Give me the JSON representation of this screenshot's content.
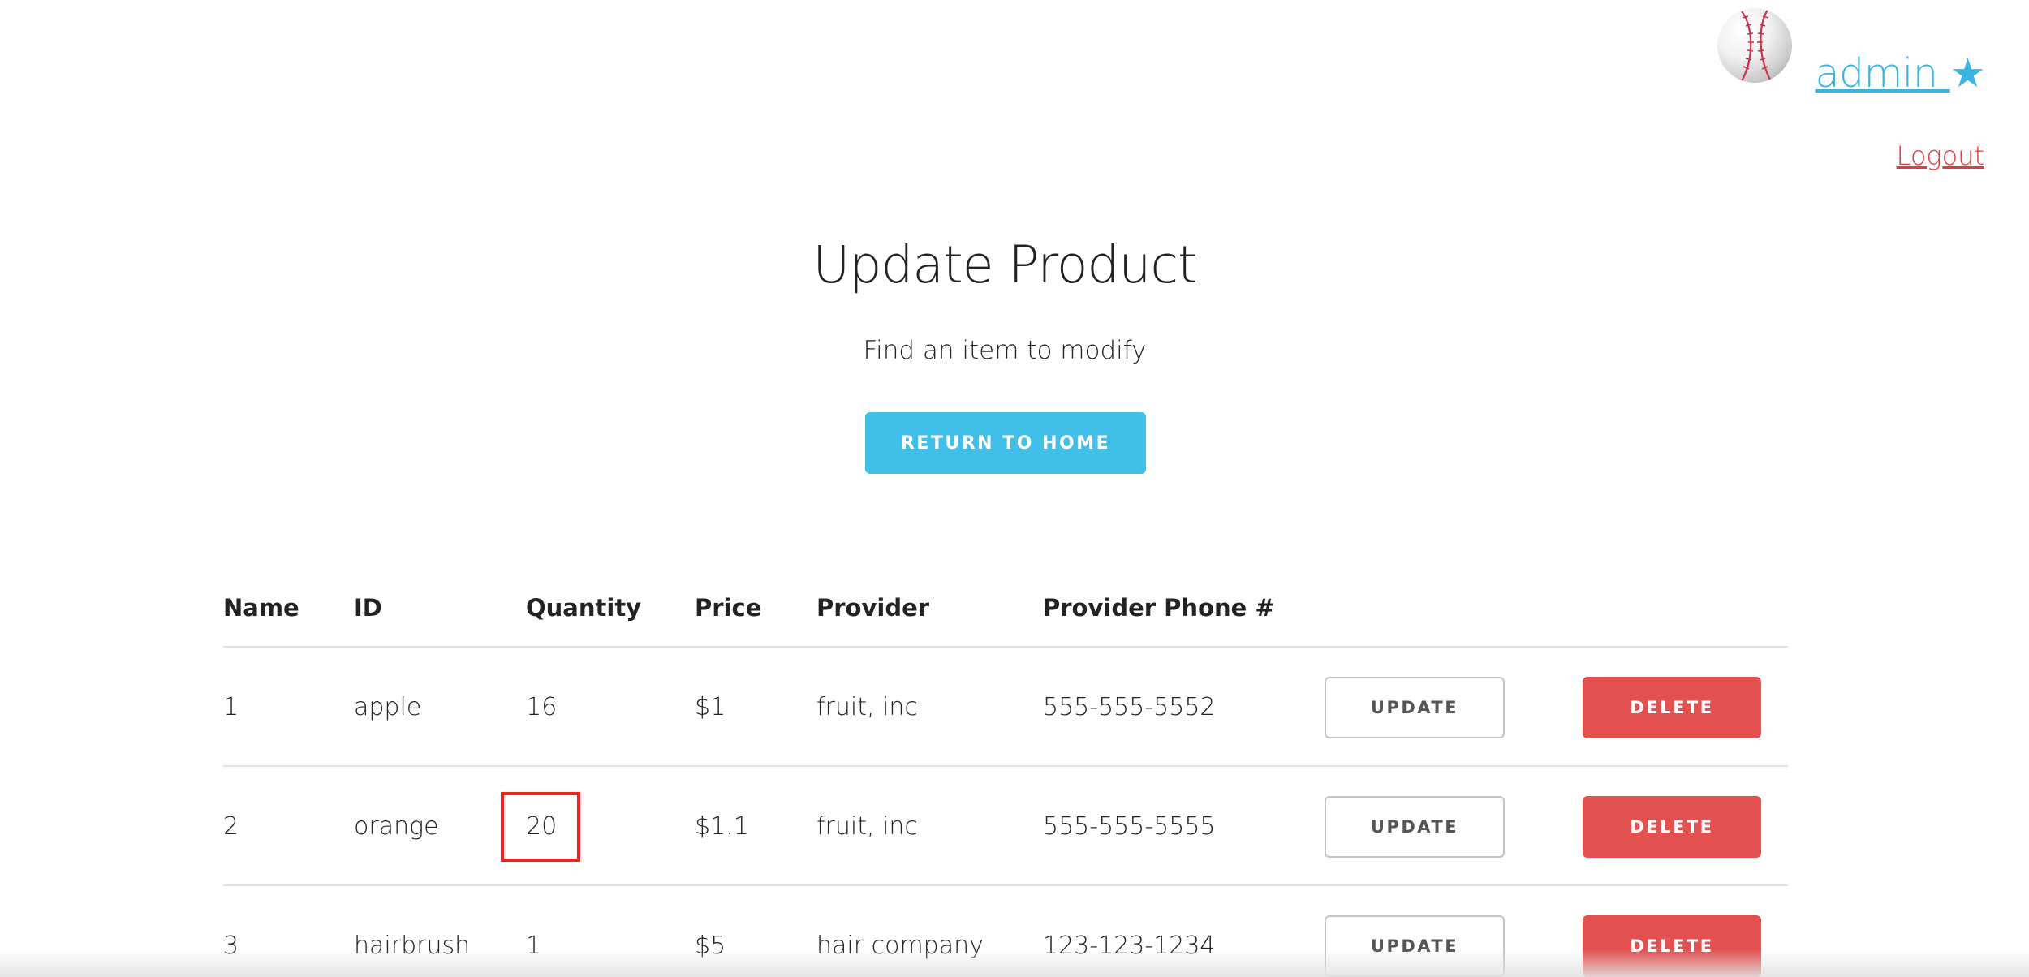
{
  "user": {
    "username": "admin",
    "star_glyph": "★",
    "logout_label": "Logout",
    "avatar_icon": "baseball-icon",
    "accent_color": "#3ab4e2",
    "logout_color": "#e63a3a"
  },
  "hero": {
    "title": "Update Product",
    "subtitle": "Find an item to modify",
    "return_label": "RETURN TO HOME",
    "return_color": "#40bfe9"
  },
  "table": {
    "headers": [
      "Name",
      "ID",
      "Quantity",
      "Price",
      "Provider",
      "Provider Phone #"
    ],
    "update_label": "UPDATE",
    "delete_label": "DELETE",
    "delete_color": "#e25050",
    "highlight_color": "#e8261f",
    "rows": [
      {
        "name": "1",
        "id": "apple",
        "quantity": "16",
        "price": "$1",
        "provider": "fruit, inc",
        "phone": "555-555-5552",
        "highlighted": false
      },
      {
        "name": "2",
        "id": "orange",
        "quantity": "20",
        "price": "$1.1",
        "provider": "fruit, inc",
        "phone": "555-555-5555",
        "highlighted": true
      },
      {
        "name": "3",
        "id": "hairbrush",
        "quantity": "1",
        "price": "$5",
        "provider": "hair company",
        "phone": "123-123-1234",
        "highlighted": false
      }
    ]
  }
}
